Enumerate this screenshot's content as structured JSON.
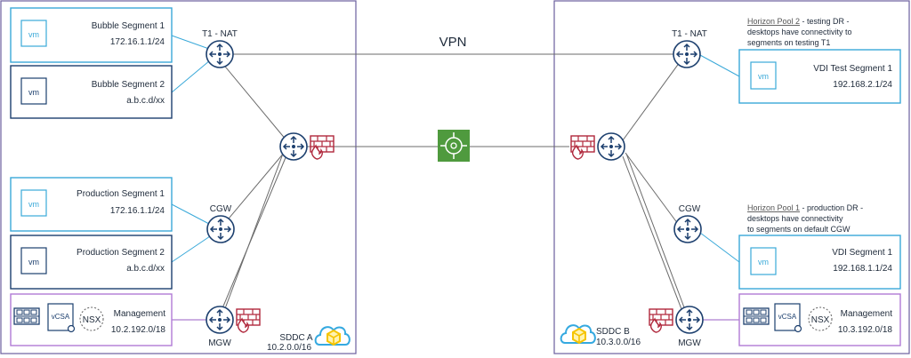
{
  "colors": {
    "sddc_border": "#6b5f9e",
    "segment_blue": "#3aa9d9",
    "segment_dark": "#1c3f6e",
    "management_purple": "#b07ad6",
    "router": "#1c3f6e",
    "firewall": "#b0283c",
    "vpn_gateway": "#4f9a3e",
    "cloud_yellow": "#f6c400",
    "cloud_blue": "#35a9e0",
    "line_gray": "#6b6b6b",
    "line_blue": "#3aa9d9",
    "line_purple": "#9a5cc6"
  },
  "vpn": {
    "label": "VPN"
  },
  "sddc_a": {
    "name": "SDDC A",
    "cidr": "10.2.0.0/16",
    "routers": {
      "t1": "T1 - NAT",
      "cgw": "CGW",
      "mgw": "MGW"
    },
    "segments": [
      {
        "vm": "vm",
        "name": "Bubble Segment 1",
        "cidr": "172.16.1.1/24"
      },
      {
        "vm": "vm",
        "name": "Bubble Segment 2",
        "cidr": "a.b.c.d/xx"
      },
      {
        "vm": "vm",
        "name": "Production Segment 1",
        "cidr": "172.16.1.1/24"
      },
      {
        "vm": "vm",
        "name": "Production Segment 2",
        "cidr": "a.b.c.d/xx"
      }
    ],
    "management": {
      "vcsa": "vCSA",
      "nsx": "NSX",
      "name": "Management",
      "cidr": "10.2.192.0/18"
    }
  },
  "sddc_b": {
    "name": "SDDC B",
    "cidr": "10.3.0.0/16",
    "routers": {
      "t1": "T1 - NAT",
      "cgw": "CGW",
      "mgw": "MGW"
    },
    "notes": {
      "pool2_title": "Horizon Pool 2",
      "pool2_line1": " - testing DR -",
      "pool2_line2": "desktops have connectivity to",
      "pool2_line3": "segments on testing T1",
      "pool1_title": "Horizon Pool 1",
      "pool1_line1": " - production DR -",
      "pool1_line2": "desktops have connectivity",
      "pool1_line3": "to segments on default CGW"
    },
    "segments": [
      {
        "vm": "vm",
        "name": "VDI Test Segment 1",
        "cidr": "192.168.2.1/24"
      },
      {
        "vm": "vm",
        "name": "VDI Segment 1",
        "cidr": "192.168.1.1/24"
      }
    ],
    "management": {
      "vcsa": "vCSA",
      "nsx": "NSX",
      "name": "Management",
      "cidr": "10.3.192.0/18"
    }
  }
}
